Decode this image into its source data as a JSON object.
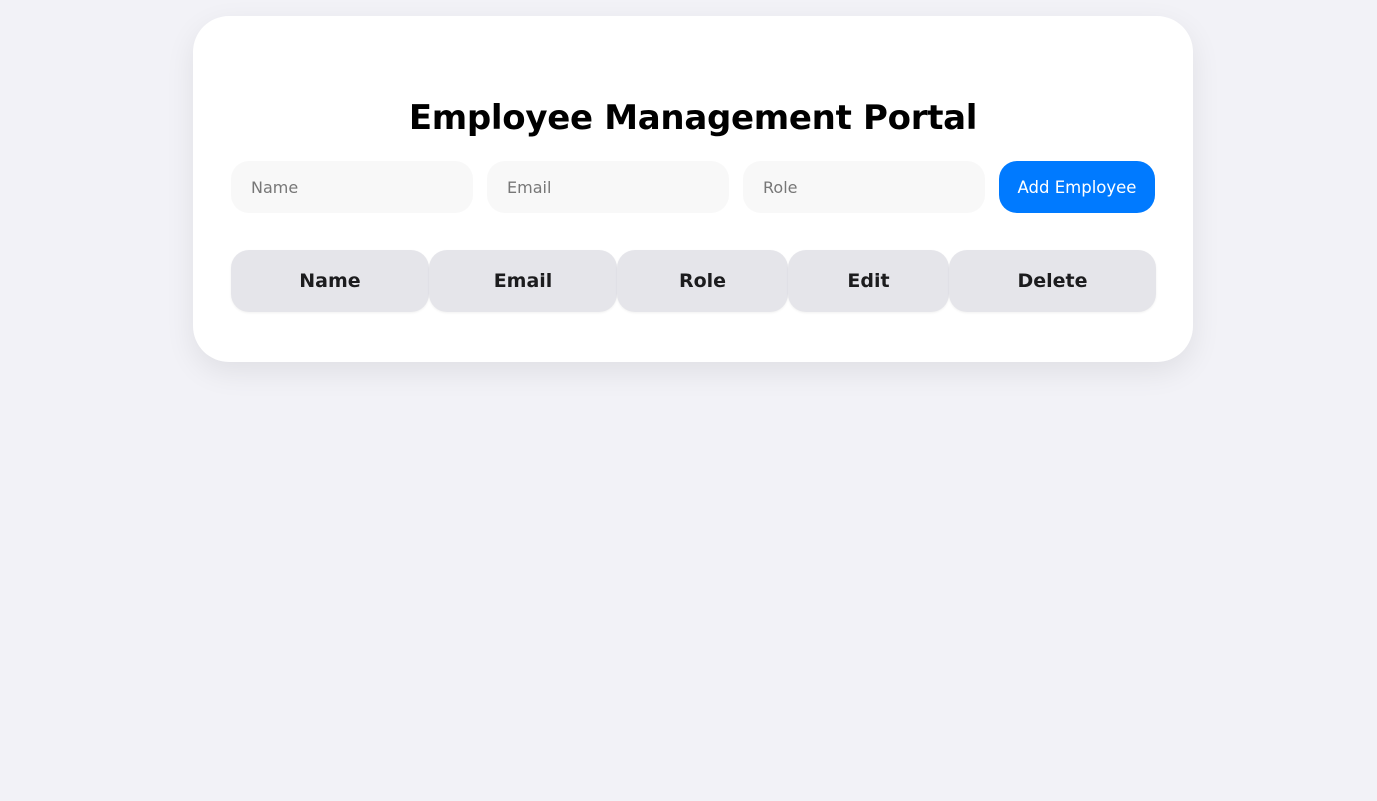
{
  "page": {
    "title": "Employee Management Portal"
  },
  "form": {
    "name_placeholder": "Name",
    "name_value": "",
    "email_placeholder": "Email",
    "email_value": "",
    "role_placeholder": "Role",
    "role_value": "",
    "add_button_label": "Add Employee"
  },
  "table": {
    "columns": [
      "Name",
      "Email",
      "Role",
      "Edit",
      "Delete"
    ],
    "rows": []
  },
  "colors": {
    "background": "#f2f2f7",
    "card": "#ffffff",
    "accent": "#007aff",
    "header_cell": "#e5e5ea",
    "input_bg": "#f8f8f8"
  }
}
